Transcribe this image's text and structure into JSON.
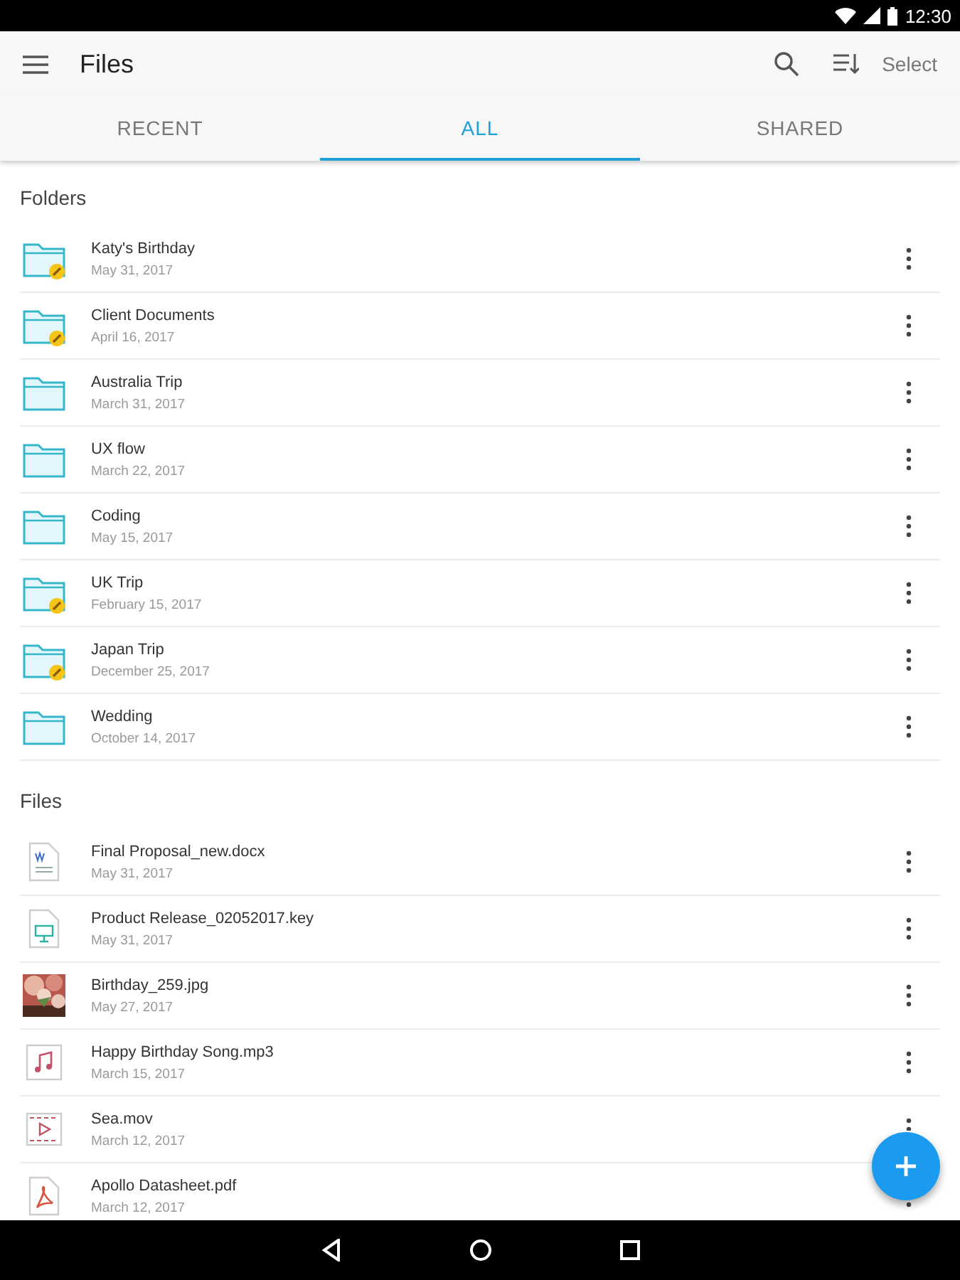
{
  "status_bar": {
    "time": "12:30"
  },
  "app_bar": {
    "title": "Files",
    "select": "Select"
  },
  "tabs": [
    {
      "label": "RECENT",
      "selected": false
    },
    {
      "label": "ALL",
      "selected": true
    },
    {
      "label": "SHARED",
      "selected": false
    }
  ],
  "folders": {
    "heading": "Folders",
    "items": [
      {
        "name": "Katy's Birthday",
        "date": "May 31, 2017",
        "shared": true
      },
      {
        "name": "Client Documents",
        "date": "April 16, 2017",
        "shared": true
      },
      {
        "name": "Australia Trip",
        "date": "March 31, 2017",
        "shared": false
      },
      {
        "name": "UX flow",
        "date": "March 22, 2017",
        "shared": false
      },
      {
        "name": "Coding",
        "date": "May 15, 2017",
        "shared": false
      },
      {
        "name": "UK Trip",
        "date": "February 15, 2017",
        "shared": true
      },
      {
        "name": "Japan Trip",
        "date": "December 25, 2017",
        "shared": true
      },
      {
        "name": "Wedding",
        "date": "October 14, 2017",
        "shared": false
      }
    ]
  },
  "files": {
    "heading": "Files",
    "items": [
      {
        "name": "Final Proposal_new.docx",
        "date": "May 31, 2017",
        "kind": "doc"
      },
      {
        "name": "Product Release_02052017.key",
        "date": "May 31, 2017",
        "kind": "slides"
      },
      {
        "name": "Birthday_259.jpg",
        "date": "May 27, 2017"
      },
      {
        "name": "Happy Birthday Song.mp3",
        "date": "March 15, 2017",
        "kind": "audio"
      },
      {
        "name": "Sea.mov",
        "date": "March 12, 2017",
        "kind": "video"
      },
      {
        "name": "Apollo Datasheet.pdf",
        "date": "March 12, 2017",
        "kind": "pdf"
      }
    ]
  }
}
